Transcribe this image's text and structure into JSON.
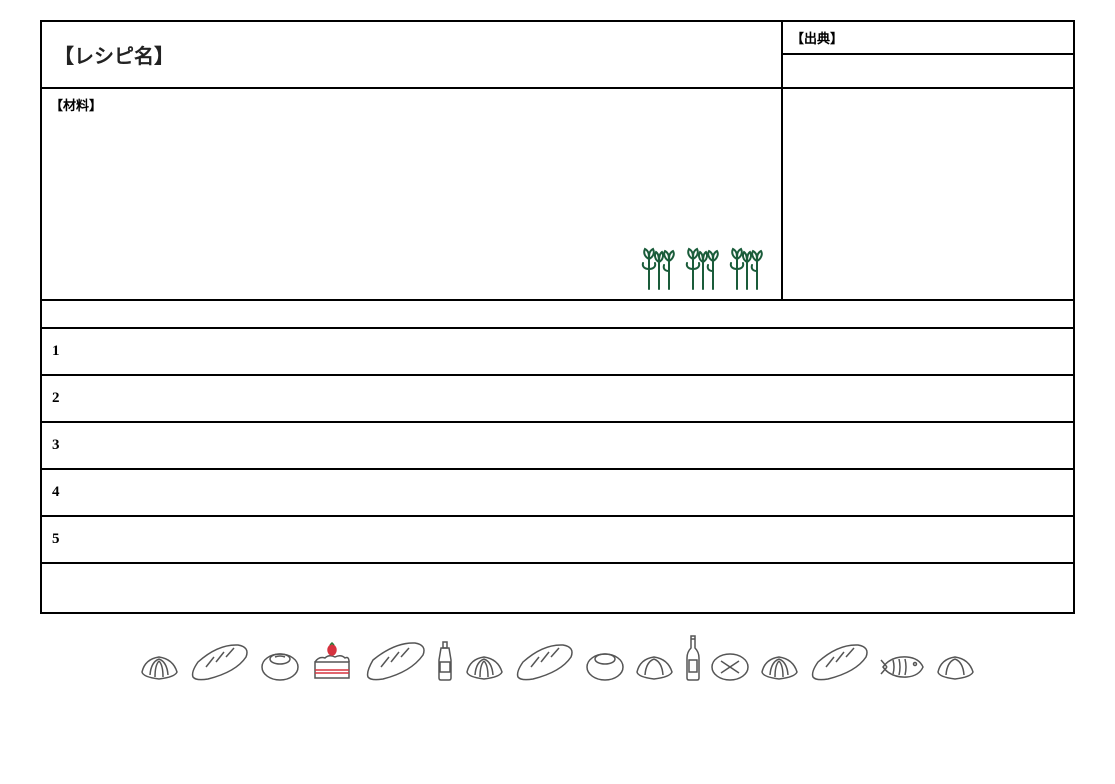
{
  "header": {
    "recipe_name_label": "【レシピ名】",
    "source_label": "【出典】",
    "ingredients_label": "【材料】"
  },
  "steps": [
    "1",
    "2",
    "3",
    "4",
    "5"
  ],
  "icons": {
    "sprout_color": "#1a5c3a",
    "cake_accent": "#d6333f"
  }
}
